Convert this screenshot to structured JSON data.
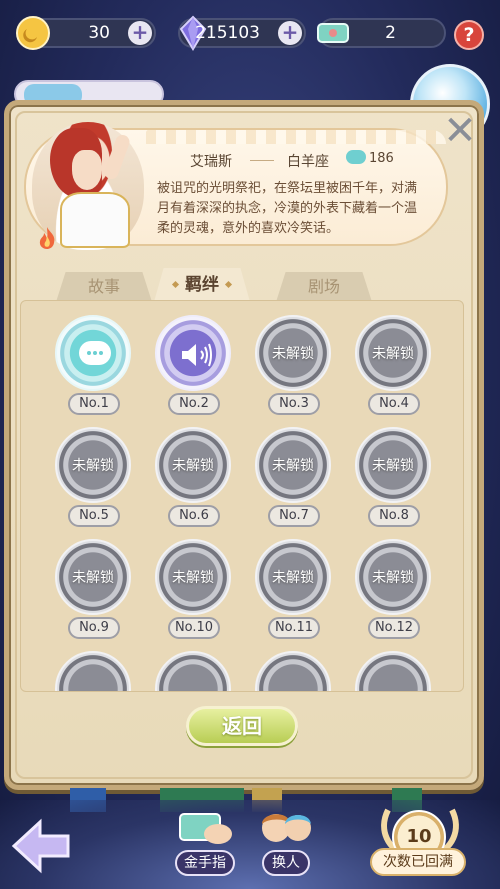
{
  "currency": {
    "coins": "30",
    "crystals": "215103",
    "tickets": "2",
    "help": "?"
  },
  "character": {
    "name": "艾瑞斯",
    "sign": "白羊座",
    "likes": "186",
    "description": "被诅咒的光明祭祀，在祭坛里被困千年，对满月有着深深的执念，冷漠的外表下藏着一个温柔的灵魂，意外的喜欢冷笑话。"
  },
  "tabs": {
    "story": "故事",
    "bond": "羁绊",
    "theater": "剧场"
  },
  "bonds": [
    {
      "label": "No.1",
      "state": "chat"
    },
    {
      "label": "No.2",
      "state": "voice"
    },
    {
      "label": "No.3",
      "state": "locked",
      "text": "未解锁"
    },
    {
      "label": "No.4",
      "state": "locked",
      "text": "未解锁"
    },
    {
      "label": "No.5",
      "state": "locked",
      "text": "未解锁"
    },
    {
      "label": "No.6",
      "state": "locked",
      "text": "未解锁"
    },
    {
      "label": "No.7",
      "state": "locked",
      "text": "未解锁"
    },
    {
      "label": "No.8",
      "state": "locked",
      "text": "未解锁"
    },
    {
      "label": "No.9",
      "state": "locked",
      "text": "未解锁"
    },
    {
      "label": "No.10",
      "state": "locked",
      "text": "未解锁"
    },
    {
      "label": "No.11",
      "state": "locked",
      "text": "未解锁"
    },
    {
      "label": "No.12",
      "state": "locked",
      "text": "未解锁"
    }
  ],
  "return_label": "返回",
  "bottom": {
    "gold_finger": "金手指",
    "swap": "换人",
    "count": "10",
    "count_status": "次数已回满"
  },
  "colors": {
    "panel": "#efe3c9",
    "accent_green": "#b8cd54",
    "background": "#232b5c"
  }
}
